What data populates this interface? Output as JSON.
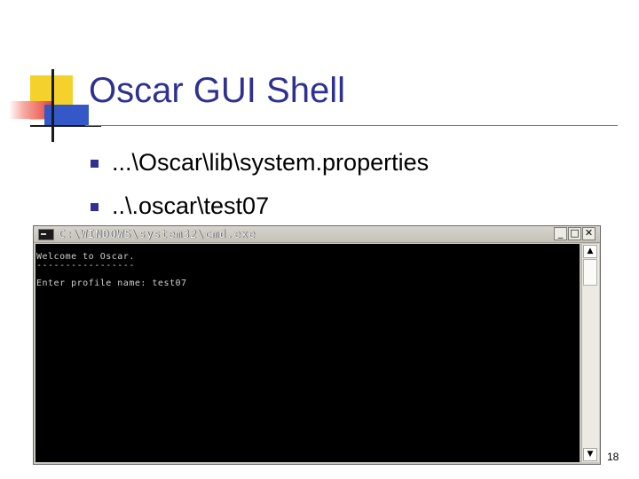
{
  "slide": {
    "title": "Oscar GUI Shell",
    "bullets": [
      "...\\Oscar\\lib\\system.properties",
      "..\\.oscar\\test07"
    ],
    "page_number": "18"
  },
  "console_window": {
    "title": "C:\\WINDOWS\\system32\\cmd.exe",
    "buttons": {
      "minimize": "_",
      "maximize": "□",
      "close": "✕"
    },
    "lines": [
      "Welcome to Oscar.",
      "-----------------",
      "Enter profile name: test07"
    ],
    "scroll_up": "▲",
    "scroll_down": "▼"
  }
}
